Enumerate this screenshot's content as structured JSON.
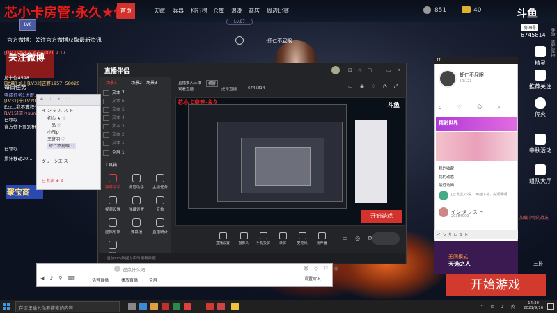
{
  "topnav": {
    "brand": "芯小卡房管·永久★位",
    "rank_badge": "LV6",
    "home": "首页",
    "items": [
      "天赋",
      "兵器",
      "排行榜",
      "仓库",
      "浪潮",
      "商店",
      "周边比赛"
    ],
    "level": "Lv.97",
    "coins": "851",
    "gold": "40",
    "platform_logo": "斗鱼",
    "room_label": "房间号",
    "room_id": "6745814"
  },
  "host_name": "·虾仁不屁眼",
  "right_sidebar": [
    "精灵",
    "推荐关注",
    "传火",
    "中秋活动",
    "组队大厅"
  ],
  "right_vertical_text": "手游一直在坚持",
  "left_chat": {
    "notice": "官方微博：关注官方微博获取最新资讯",
    "attention": "关注微博",
    "lines": [
      "[LV41]韦不 | 凌东 2021.9.17",
      "[勋章] 加十[LV32]吉野1957: 58020",
      "加十你4598",
      "每日任务",
      "完成任务1进度...",
      "[LV31]十[LV20]吉野1957: 武月孙",
      "Ezz...我不算积分...",
      "[LV15]流沙sunba...",
      "已领取",
      "官方你不要到积分...",
      "已领取",
      "累计移动20..."
    ],
    "treasure": "聚宝商"
  },
  "mainwin": {
    "logo": "直播伴侣",
    "tabs": [
      "场景1",
      "场景2",
      "场景3"
    ],
    "scenes": [
      "文本 7",
      "文本 6",
      "文本 5",
      "文本 4",
      "文本 3",
      "文本 2",
      "文本 1",
      "全屏 1"
    ],
    "toolbox_title": "工具箱",
    "tools": [
      {
        "label": "弹幕助手",
        "red": true
      },
      {
        "label": "房管助手",
        "red": false
      },
      {
        "label": "主播任务",
        "red": false
      },
      {
        "label": "视频设置",
        "red": false
      },
      {
        "label": "弹幕设置",
        "red": false
      },
      {
        "label": "音效",
        "red": false
      },
      {
        "label": "虚拟形象",
        "red": false
      },
      {
        "label": "弹幕墙",
        "red": false
      },
      {
        "label": "直播统计",
        "red": false
      },
      {
        "label": "更多",
        "red": false
      }
    ],
    "top_tabs": [
      "直播推入三维",
      "横屏",
      "观看直播",
      "虎牙直播"
    ],
    "room_tag": "6745814",
    "bottom_tools": [
      "直播设置",
      "摄像头",
      "手机投屏",
      "录屏",
      "麦克风",
      "扬声器"
    ],
    "status": "1.当前FPS数据为实时更新数据"
  },
  "preview": {
    "brand": "芯小卡房管·永久",
    "logo": "斗鱼",
    "start": "开始游戏"
  },
  "friends": {
    "rows": [
      "イ ン タ ル ス ト",
      "初心 ★ ♡",
      "一品 ♡",
      "小Flip",
      "王斑明 ♡",
      "虾仁不屁眼 ♡",
      "グリーンエ ス",
      "已发表 ★ 4"
    ]
  },
  "chatbar": {
    "placeholder": "说点什么吧...",
    "items": [
      "语音直播",
      "播放直播",
      "全屏"
    ],
    "send": "设置写入"
  },
  "phone": {
    "head": "YY",
    "name": "虾仁不屁眼",
    "yy": "ID:123",
    "banner": "精彩世界",
    "rows": [
      "我的收藏",
      "我的动态",
      "最近访问",
      "[已发送]小说... 可能下载，先逛啊啊"
    ],
    "user": "イ ン タ レ ス ト",
    "user_sub": "29384000",
    "chat": "イ ン タ レ ス ト",
    "bottom_title": "无间模式",
    "bottom_sub": "天选之人",
    "bottom_right": "三排"
  },
  "start_game": "开始游戏",
  "right_deco": "加载中你的战友",
  "taskbar": {
    "search": "在这里输入你要搜索的内容",
    "time": "14:30",
    "date": "2021/9/16"
  }
}
